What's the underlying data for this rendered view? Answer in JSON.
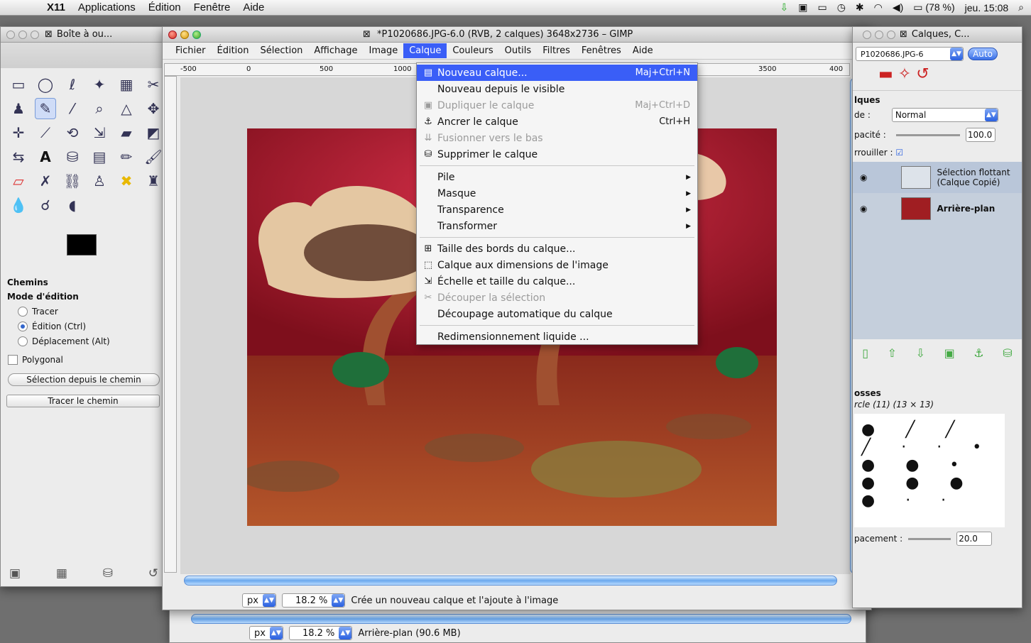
{
  "menubar": {
    "app": "X11",
    "items": [
      "Applications",
      "Édition",
      "Fenêtre",
      "Aide"
    ],
    "battery": "(78 %)",
    "clock": "jeu. 15:08"
  },
  "toolbox": {
    "title": "Boîte à ou...",
    "paths_title": "Chemins",
    "mode_label": "Mode d'édition",
    "modes": [
      "Tracer",
      "Édition (Ctrl)",
      "Déplacement (Alt)"
    ],
    "selected_mode": 1,
    "polygonal": "Polygonal",
    "btn_selection": "Sélection depuis le chemin",
    "btn_trace": "Tracer le chemin"
  },
  "image_window": {
    "title": "*P1020686.JPG-6.0 (RVB, 2 calques) 3648x2736 – GIMP",
    "menu": [
      "Fichier",
      "Édition",
      "Sélection",
      "Affichage",
      "Image",
      "Calque",
      "Couleurs",
      "Outils",
      "Filtres",
      "Fenêtres",
      "Aide"
    ],
    "active_menu": "Calque",
    "ruler_labels": [
      "-500",
      "0",
      "500",
      "1000",
      "3500",
      "400"
    ],
    "unit": "px",
    "zoom": "18.2 %",
    "status": "Crée un nouveau calque et l'ajoute à l'image"
  },
  "back_window": {
    "unit": "px",
    "zoom": "18.2 %",
    "status": "Arrière-plan (90.6 MB)"
  },
  "layer_menu": {
    "items": [
      {
        "label": "Nouveau calque...",
        "accel": "Maj+Ctrl+N",
        "icon": "new-layer-icon",
        "state": "highlight"
      },
      {
        "label": "Nouveau depuis le visible",
        "accel": "",
        "icon": "",
        "state": "normal"
      },
      {
        "label": "Dupliquer le calque",
        "accel": "Maj+Ctrl+D",
        "icon": "duplicate-icon",
        "state": "disabled"
      },
      {
        "label": "Ancrer le calque",
        "accel": "Ctrl+H",
        "icon": "anchor-icon",
        "state": "normal"
      },
      {
        "label": "Fusionner vers le bas",
        "accel": "",
        "icon": "merge-icon",
        "state": "disabled"
      },
      {
        "label": "Supprimer le calque",
        "accel": "",
        "icon": "trash-icon",
        "state": "normal"
      },
      {
        "sep": true
      },
      {
        "label": "Pile",
        "sub": true
      },
      {
        "label": "Masque",
        "sub": true
      },
      {
        "label": "Transparence",
        "sub": true
      },
      {
        "label": "Transformer",
        "sub": true
      },
      {
        "sep": true
      },
      {
        "label": "Taille des bords du calque...",
        "icon": "layer-size-icon",
        "state": "normal"
      },
      {
        "label": "Calque aux dimensions de l'image",
        "icon": "layer-image-size-icon",
        "state": "normal"
      },
      {
        "label": "Échelle et taille du calque...",
        "icon": "scale-layer-icon",
        "state": "normal"
      },
      {
        "label": "Découper la sélection",
        "icon": "crop-icon",
        "state": "disabled"
      },
      {
        "label": "Découpage automatique du calque",
        "icon": "",
        "state": "normal"
      },
      {
        "sep": true
      },
      {
        "label": "Redimensionnement liquide ...",
        "icon": "",
        "state": "normal"
      }
    ]
  },
  "layers": {
    "title": "Calques, C...",
    "image_select": "P1020686.JPG-6",
    "auto": "Auto",
    "section": "lques",
    "mode_label": "de :",
    "mode": "Normal",
    "opacity_label": "pacité :",
    "opacity": "100.0",
    "lock_label": "rrouiller :",
    "layer1_line1": "Sélection flottant",
    "layer1_line2": "(Calque Copié)",
    "layer2": "Arrière-plan",
    "brush_section": "osses",
    "brush_name": "rcle (11) (13 × 13)",
    "spacing_label": "pacement :",
    "spacing": "20.0"
  },
  "colors": {
    "accent": "#3a5ef7",
    "photo_bg": "#b42636"
  }
}
